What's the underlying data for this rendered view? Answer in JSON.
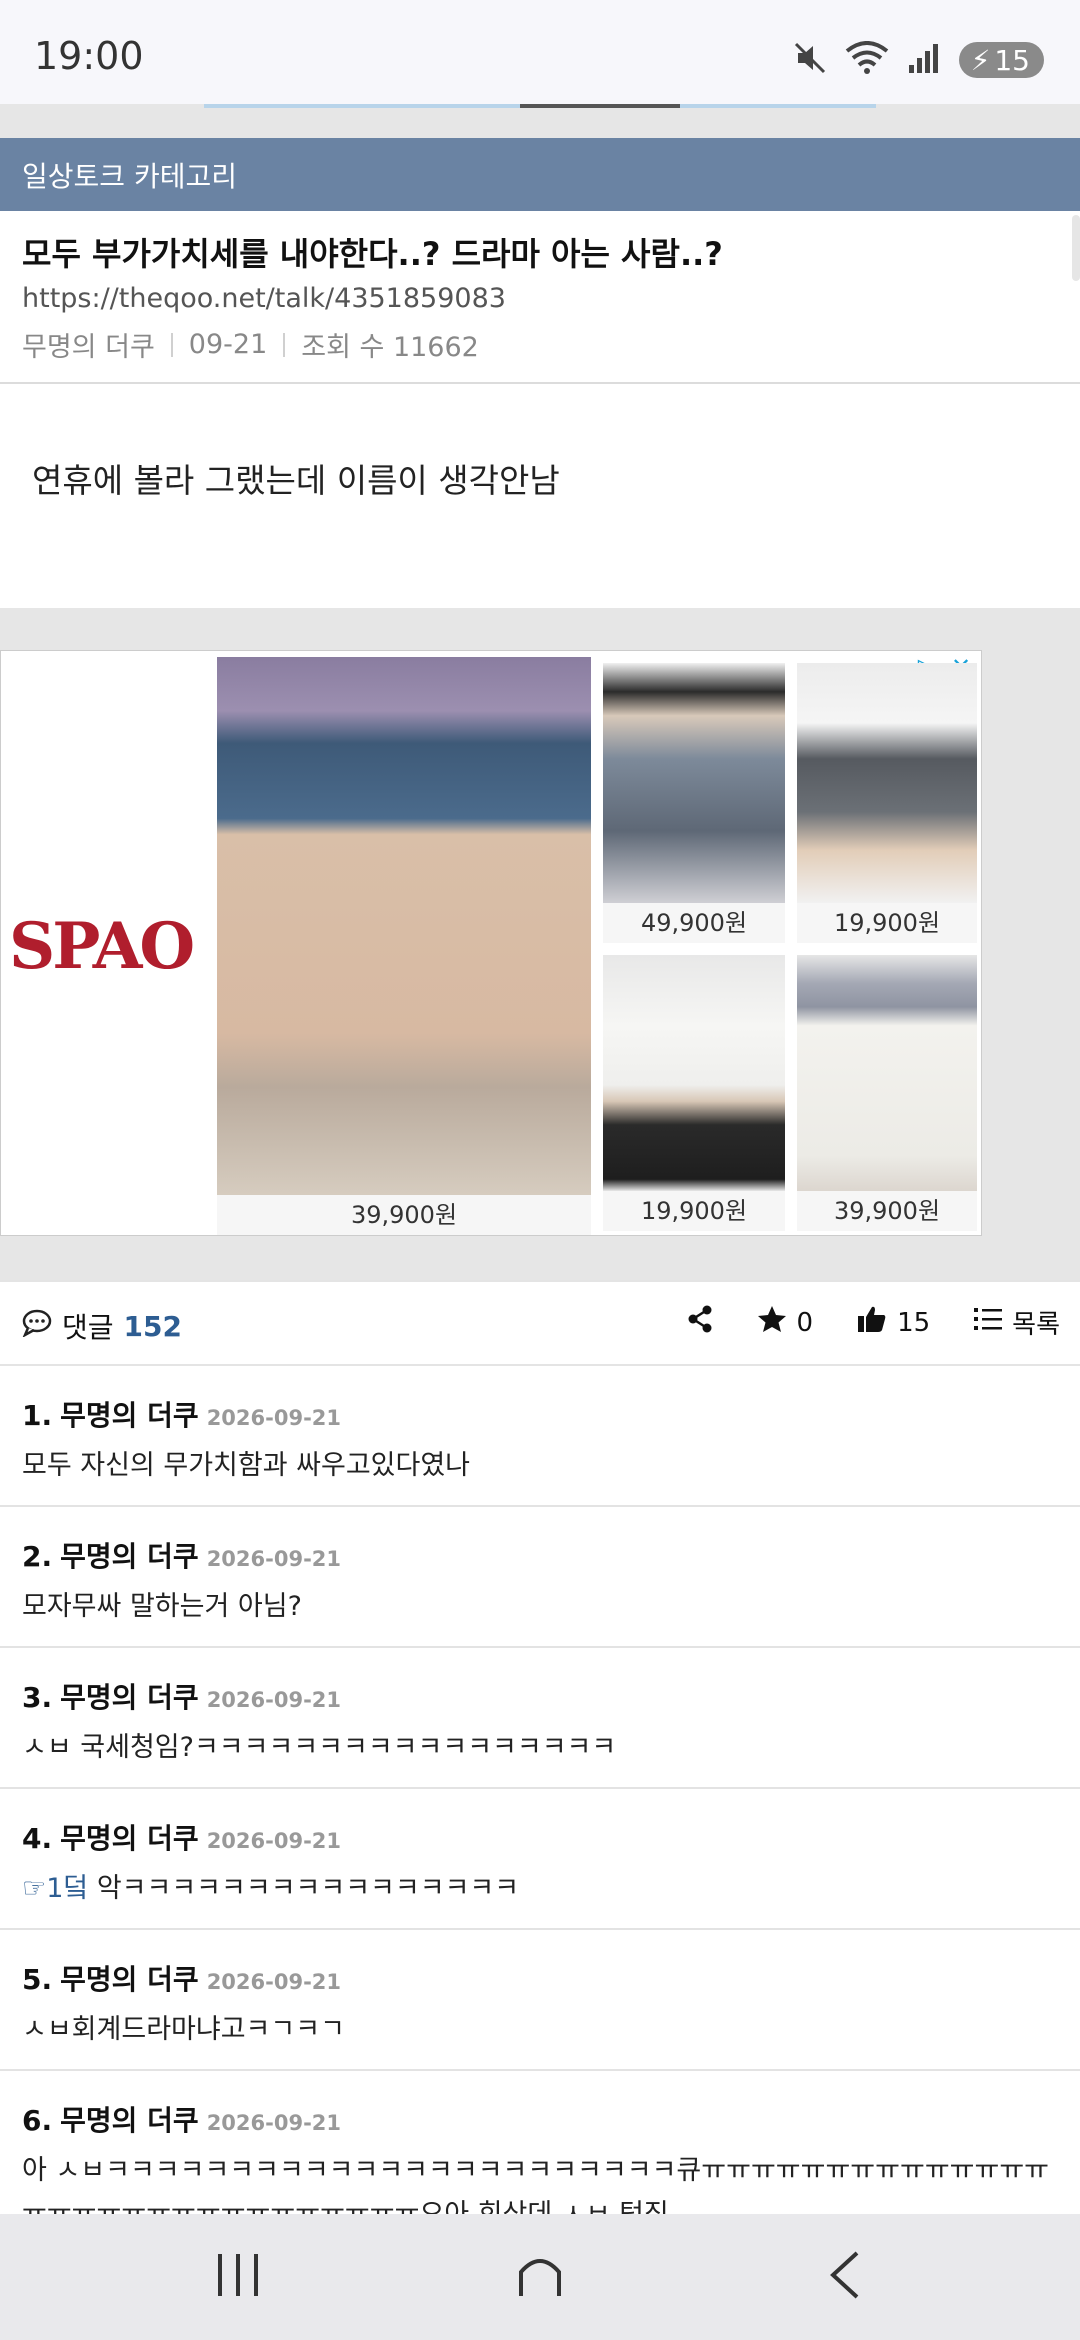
{
  "status": {
    "time": "19:00",
    "battery": "15",
    "wifi_badge": "6"
  },
  "category": {
    "label": "일상토크 카테고리"
  },
  "article": {
    "title": "모두 부가가치세를 내야한다..? 드라마 아는 사람..?",
    "url": "https://theqoo.net/talk/4351859083",
    "author": "무명의 더쿠",
    "date": "09-21",
    "views": "조회 수 11662",
    "body": "연휴에 볼라 그랬는데 이름이 생각안남"
  },
  "ad": {
    "brand": "SPAO",
    "products": [
      {
        "price": "39,900원"
      },
      {
        "price": "49,900원"
      },
      {
        "price": "19,900원"
      },
      {
        "price": "19,900원"
      },
      {
        "price": "39,900원"
      }
    ]
  },
  "toolbar": {
    "comments_label": "댓글",
    "comments_count": "152",
    "star_count": "0",
    "like_count": "15",
    "list_label": "목록"
  },
  "comments": [
    {
      "num": "1.",
      "author": "무명의 더쿠",
      "date": "2026-09-21",
      "text": "모두 자신의 무가치함과 싸우고있다였나"
    },
    {
      "num": "2.",
      "author": "무명의 더쿠",
      "date": "2026-09-21",
      "text": "모자무싸 말하는거 아님?"
    },
    {
      "num": "3.",
      "author": "무명의 더쿠",
      "date": "2026-09-21",
      "text": "ㅅㅂ 국세청임?ㅋㅋㅋㅋㅋㅋㅋㅋㅋㅋㅋㅋㅋㅋㅋㅋㅋ"
    },
    {
      "num": "4.",
      "author": "무명의 더쿠",
      "date": "2026-09-21",
      "link": "☞1덬",
      "text": " 악ㅋㅋㅋㅋㅋㅋㅋㅋㅋㅋㅋㅋㅋㅋㅋㅋ"
    },
    {
      "num": "5.",
      "author": "무명의 더쿠",
      "date": "2026-09-21",
      "text": "ㅅㅂ회계드라마냐고ㅋㄱㅋㄱ"
    },
    {
      "num": "6.",
      "author": "무명의 더쿠",
      "date": "2026-09-21",
      "text": "아 ㅅㅂㅋㅋㅋㅋㅋㅋㅋㅋㅋㅋㅋㅋㅋㅋㅋㅋㅋㅋㅋㅋㅋㅋㅋ큐ㅠㅠㅠㅠㅠㅠㅠㅠㅠㅠㅠㅠㅠㅠㅠㅠㅠㅠㅠㅠㅠㅠㅠㅠㅠㅠㅠㅠㅠㅠ오아 회상데 ㅅㅂ 텅징"
    }
  ],
  "colors": {
    "category_bg": "#6a83a3",
    "link": "#2d5d92",
    "brand": "#b01e2d"
  }
}
